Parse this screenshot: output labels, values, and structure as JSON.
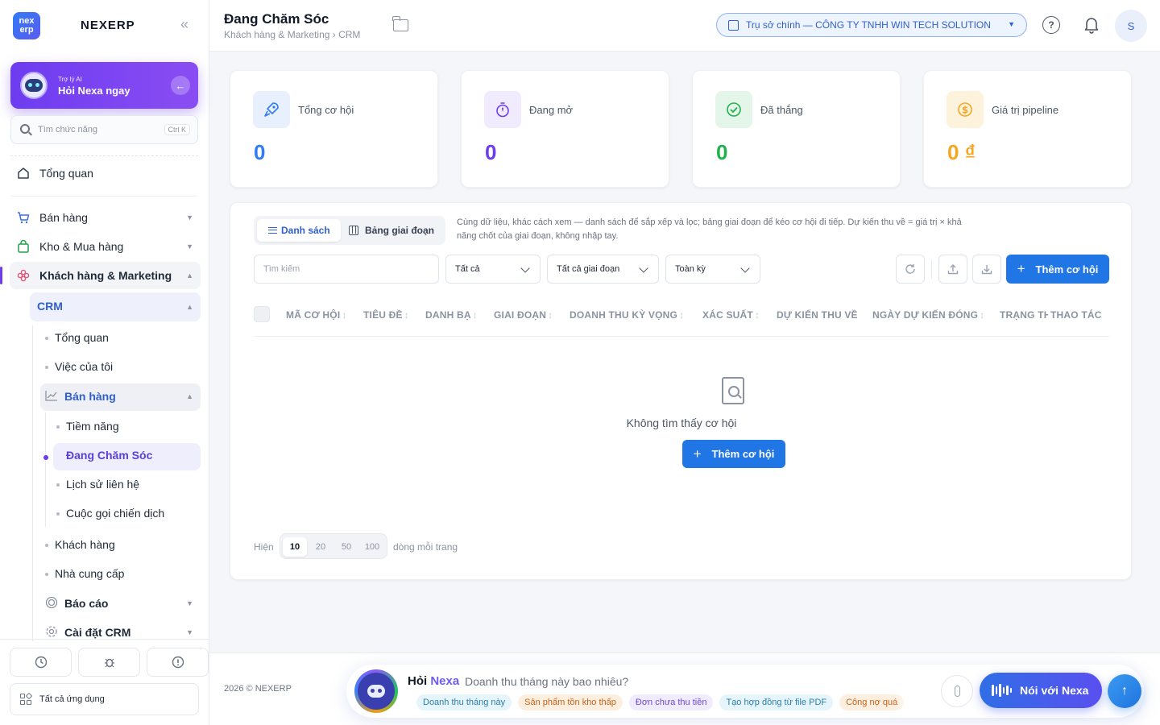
{
  "sidebar": {
    "logo_text": "nex erp",
    "brand": "NEXERP",
    "collapse_icon": "«",
    "ai": {
      "sub": "Trợ lý AI",
      "title": "Hỏi Nexa ngay",
      "go_icon": "←"
    },
    "search": {
      "placeholder": "Tìm chức năng",
      "shortcut": "Ctrl K"
    },
    "overview": "Tổng quan",
    "sales": "Bán hàng",
    "warehouse": "Kho & Mua hàng",
    "customers_marketing": "Khách hàng & Marketing",
    "crm": "CRM",
    "crm_overview": "Tổng quan",
    "my_tasks": "Việc của tôi",
    "crm_sales": "Bán hàng",
    "prospects": "Tiềm năng",
    "nurturing": "Đang Chăm Sóc",
    "contact_history": "Lịch sử liên hệ",
    "campaign_calls": "Cuộc gọi chiến dịch",
    "customers": "Khách hàng",
    "suppliers": "Nhà cung cấp",
    "reports": "Báo cáo",
    "crm_settings": "Cài đặt CRM",
    "all_apps": "Tất cả ứng dụng",
    "bottom_icons": [
      "clock-icon",
      "bug-icon",
      "alert-icon"
    ]
  },
  "header": {
    "title": "Đang Chăm Sóc",
    "breadcrumb": "Khách hàng & Marketing › CRM",
    "company": "Trụ sở chính — CÔNG TY TNHH WIN TECH SOLUTION",
    "help": "?",
    "avatar": "S"
  },
  "stats": [
    {
      "label": "Tổng cơ hội",
      "value": "0",
      "color": "#2f7cf6",
      "icon": "rocket-icon"
    },
    {
      "label": "Đang mở",
      "value": "0",
      "color": "#6d3cf0",
      "icon": "timer-icon"
    },
    {
      "label": "Đã thắng",
      "value": "0",
      "color": "#22b04b",
      "icon": "check-circle-icon"
    },
    {
      "label": "Giá trị pipeline",
      "value": "0 ₫",
      "color": "#f5a623",
      "icon": "dollar-icon"
    }
  ],
  "view": {
    "list": "Danh sách",
    "board": "Bảng giai đoạn",
    "note": "Cùng dữ liệu, khác cách xem — danh sách để sắp xếp và lọc; bảng giai đoạn để kéo cơ hội đi tiếp. Dự kiến thu về = giá trị × khả năng chốt của giai đoạn, không nhập tay."
  },
  "filters": {
    "search_placeholder": "Tìm kiếm",
    "status": "Tất cả",
    "stage": "Tất cả giai đoạn",
    "period": "Toàn kỳ",
    "add_label": "Thêm cơ hội"
  },
  "table": {
    "columns": [
      "MÃ CƠ HỘI",
      "TIÊU ĐỀ",
      "DANH BẠ",
      "GIAI ĐOẠN",
      "DOANH THU KỲ VỌNG",
      "XÁC SUẤT",
      "DỰ KIẾN THU VỀ",
      "NGÀY DỰ KIẾN ĐÓNG",
      "TRẠNG THÁI",
      "THAO TÁC"
    ],
    "empty_text": "Không tìm thấy cơ hội",
    "empty_add": "Thêm cơ hội"
  },
  "pagination": {
    "before": "Hiện",
    "sizes": [
      "10",
      "20",
      "50",
      "100"
    ],
    "selected": "10",
    "after": "dòng mỗi trang"
  },
  "footer": {
    "copyright": "2026 © NEXERP",
    "ask": "Hỏi",
    "nexa": "Nexa",
    "prompt": "Doanh thu tháng này bao nhiêu?",
    "chips": [
      {
        "label": "Doanh thu tháng này",
        "bg": "#e6f4fb",
        "fg": "#2b7fa8"
      },
      {
        "label": "Sản phẩm tồn kho thấp",
        "bg": "#fdefe0",
        "fg": "#c2621a"
      },
      {
        "label": "Đơn chưa thu tiền",
        "bg": "#f0ecfd",
        "fg": "#6d48d8"
      },
      {
        "label": "Tạo hợp đồng từ file PDF",
        "bg": "#e6f4fb",
        "fg": "#2b7fa8"
      },
      {
        "label": "Công nợ quá",
        "bg": "#fdefe0",
        "fg": "#c2621a"
      }
    ],
    "talk": "Nói với Nexa",
    "send_icon": "↑"
  }
}
